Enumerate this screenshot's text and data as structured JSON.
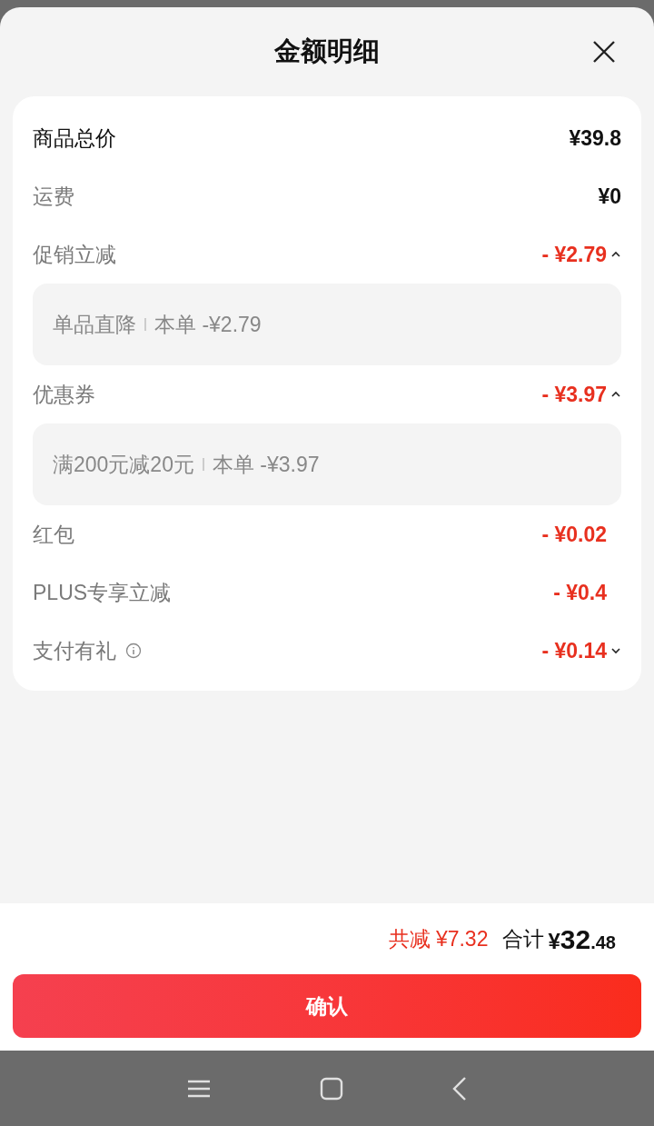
{
  "title": "金额明细",
  "rows": [
    {
      "label": "商品总价",
      "value": "¥39.8",
      "kind": "total"
    },
    {
      "label": "运费",
      "value": "¥0",
      "kind": "plain"
    },
    {
      "label": "促销立减",
      "value": "- ¥2.79",
      "kind": "discount",
      "expanded": true,
      "details": [
        {
          "name": "单品直降",
          "amount": "本单 -¥2.79"
        }
      ]
    },
    {
      "label": "优惠券",
      "value": "- ¥3.97",
      "kind": "discount",
      "expanded": true,
      "details": [
        {
          "name": "满200元减20元",
          "amount": "本单 -¥3.97"
        }
      ]
    },
    {
      "label": "红包",
      "value": "- ¥0.02",
      "kind": "discount"
    },
    {
      "label": "PLUS专享立减",
      "value": "- ¥0.4",
      "kind": "discount"
    },
    {
      "label": "支付有礼",
      "value": "- ¥0.14",
      "kind": "discount",
      "info": true,
      "expanded": false
    }
  ],
  "summary": {
    "saved": "共减 ¥7.32",
    "total_label": "合计",
    "currency": "¥",
    "total_integer": "32",
    "total_decimal": ".48"
  },
  "confirm_button": "确认"
}
